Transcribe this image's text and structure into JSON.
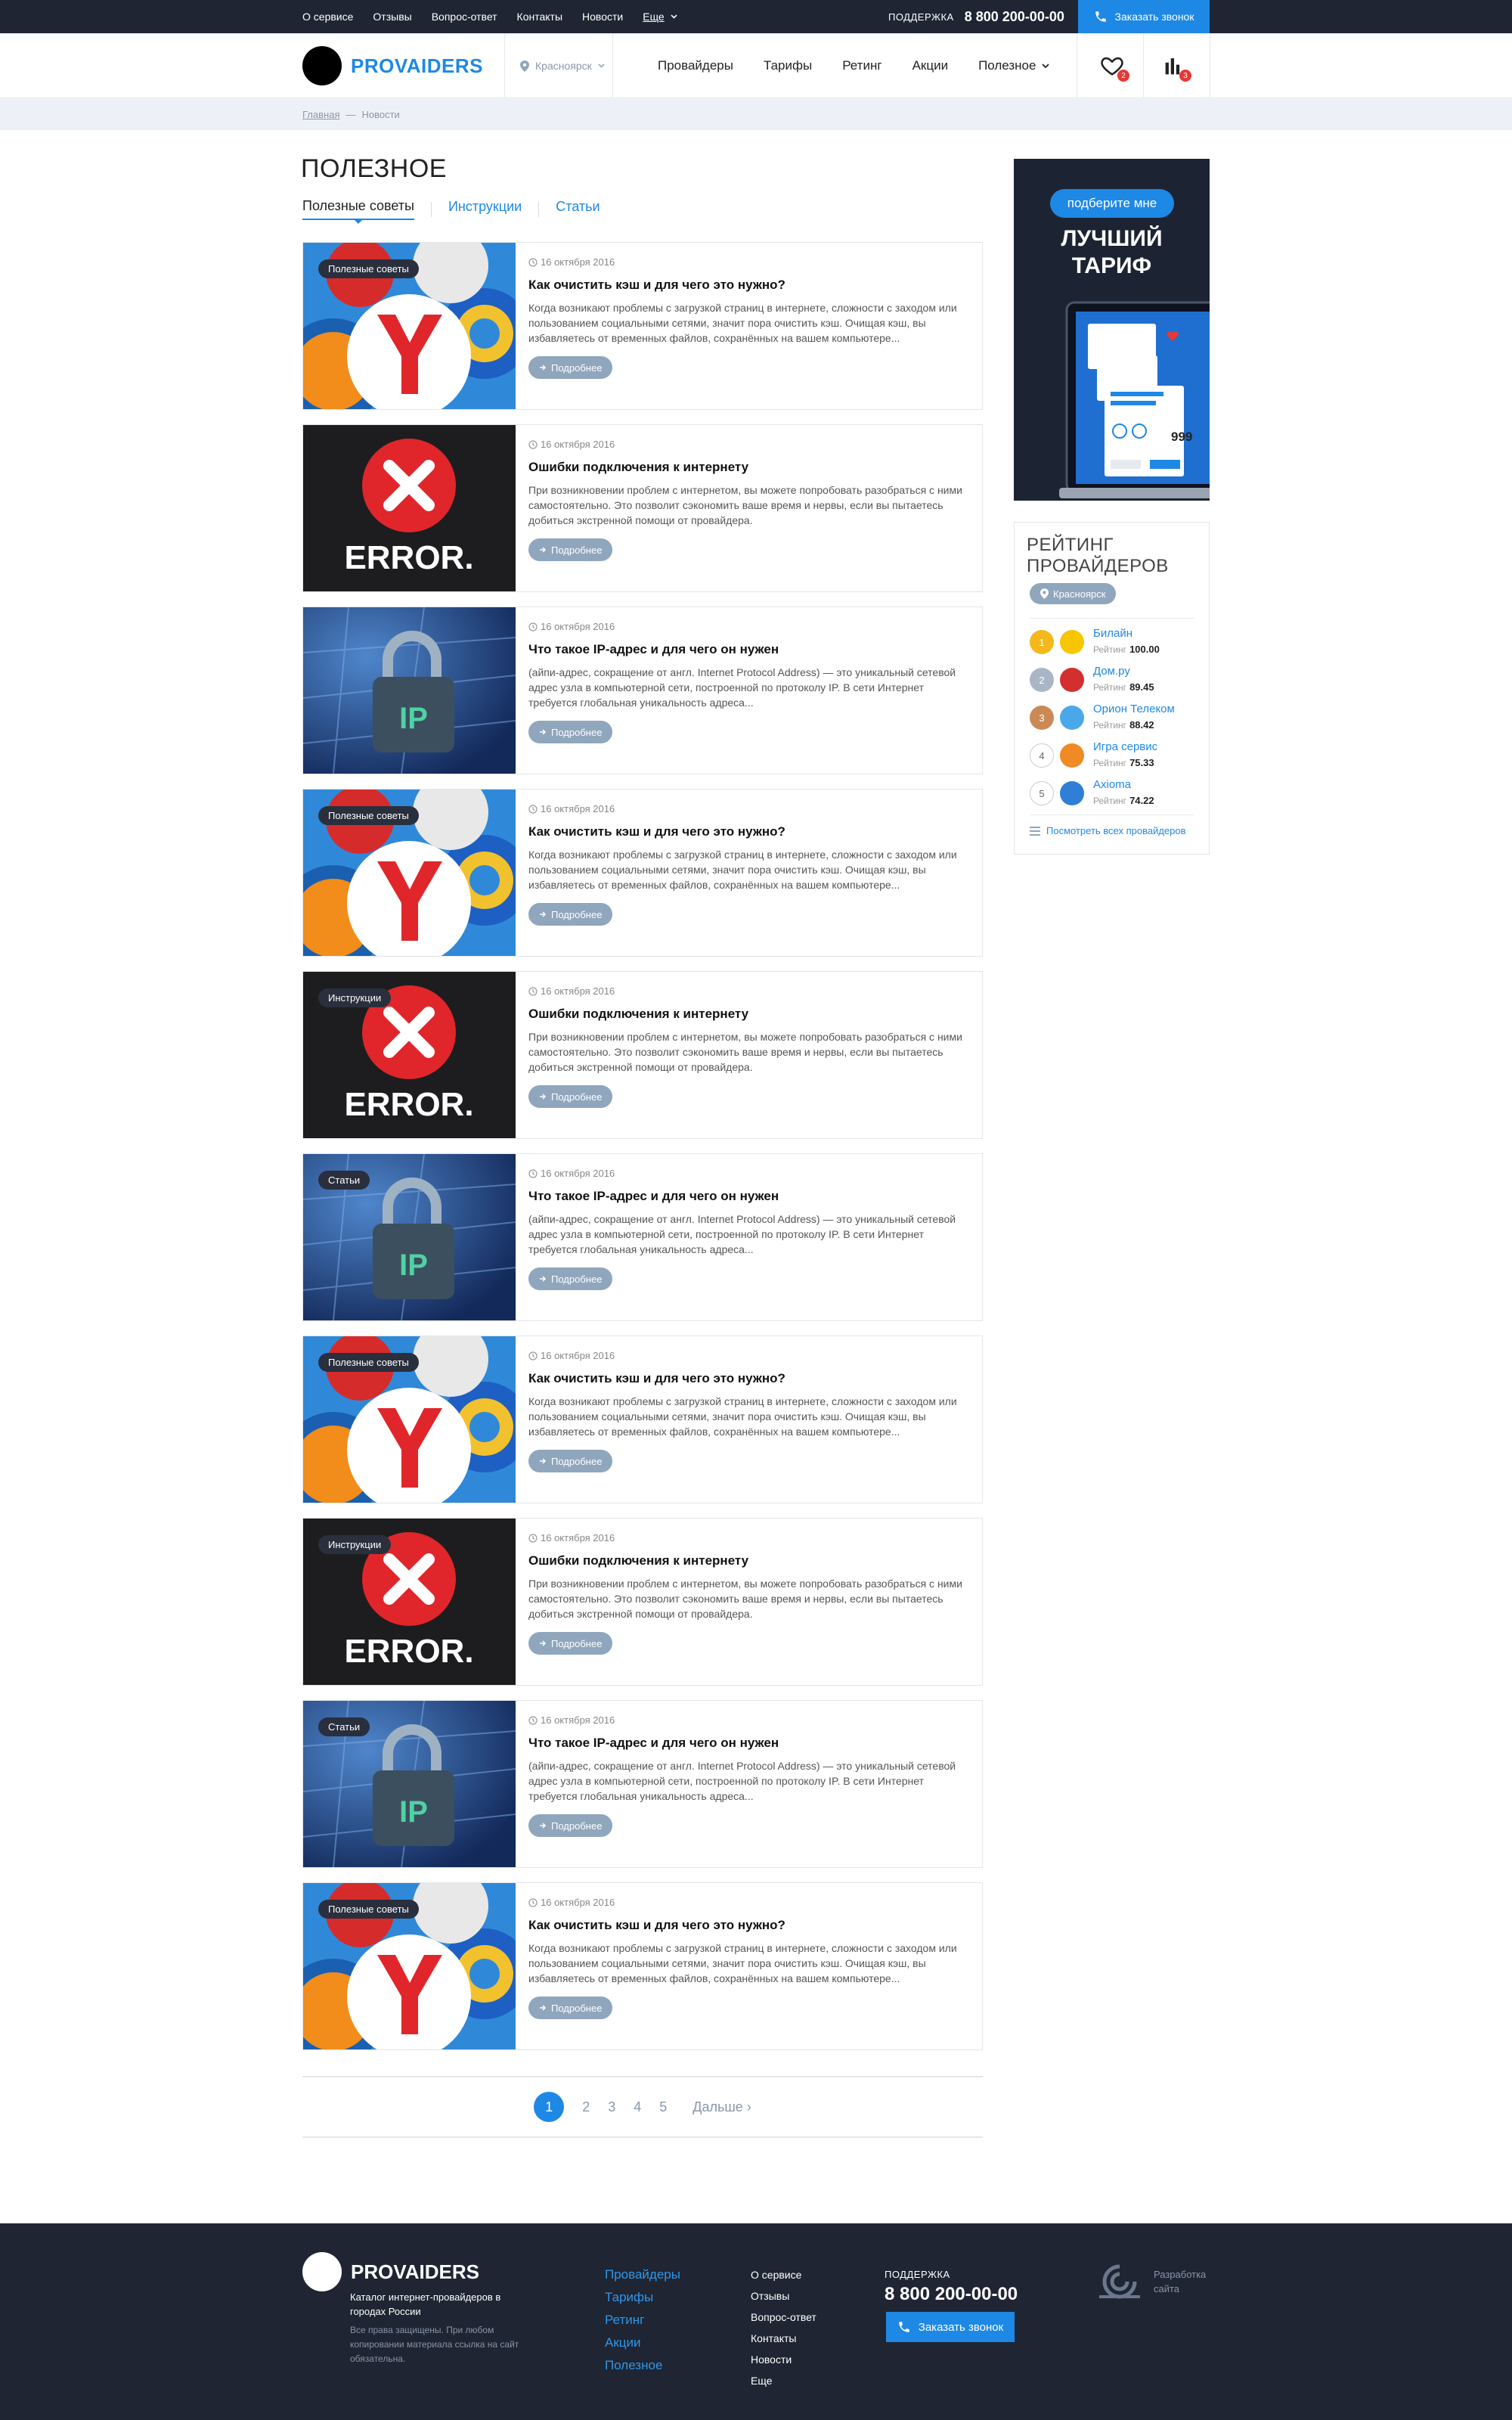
{
  "topbar": {
    "links": [
      "О сервисе",
      "Отзывы",
      "Вопрос-ответ",
      "Контакты",
      "Новости"
    ],
    "more": "Еще",
    "support_label": "ПОДДЕРЖКА",
    "support_phone": "8 800 200-00-00",
    "call_button": "Заказать звонок"
  },
  "header": {
    "logo_text": "PROVAIDERS",
    "city": "Красноярск",
    "nav": [
      "Провайдеры",
      "Тарифы",
      "Ретинг",
      "Акции"
    ],
    "nav_more": "Полезное",
    "favorites_count": "2",
    "compare_count": "3"
  },
  "breadcrumbs": {
    "home": "Главная",
    "separator": "—",
    "current": "Новости"
  },
  "page": {
    "title": "ПОЛЕЗНОЕ",
    "tabs": [
      {
        "label": "Полезные советы",
        "active": true
      },
      {
        "label": "Инструкции",
        "active": false
      },
      {
        "label": "Статьи",
        "active": false
      }
    ]
  },
  "articles": [
    {
      "art": "browsers",
      "tag": "Полезные советы",
      "date": "16 октября 2016",
      "title": "Как очистить кэш и для чего это нужно?",
      "excerpt": "Когда возникают проблемы с загрузкой страниц в интернете, сложности с заходом или пользованием социальными сетями, значит пора очистить кэш. Очищая кэш, вы избавляетесь от временных файлов, сохранённых на вашем компьютере...",
      "more": "Подробнее"
    },
    {
      "art": "error",
      "tag": "",
      "date": "16 октября 2016",
      "title": "Ошибки подключения к интернету",
      "excerpt": "При возникновении проблем с интернетом, вы можете попробовать разобраться с ними самостоятельно. Это позволит сэкономить ваше время и нервы, если вы пытаетесь добиться экстренной помощи от провайдера.",
      "more": "Подробнее"
    },
    {
      "art": "ip",
      "tag": "",
      "date": "16 октября 2016",
      "title": "Что такое IP-адрес и для чего он нужен",
      "excerpt": " (айпи-адрес, сокращение от англ. Internet Protocol Address) — это уникальный сетевой адрес узла в компьютерной сети, построенной по протоколу IP. В сети Интернет требуется глобальная уникальность адреса...",
      "more": "Подробнее"
    },
    {
      "art": "browsers",
      "tag": "Полезные советы",
      "date": "16 октября 2016",
      "title": "Как очистить кэш и для чего это нужно?",
      "excerpt": "Когда возникают проблемы с загрузкой страниц в интернете, сложности с заходом или пользованием социальными сетями, значит пора очистить кэш. Очищая кэш, вы избавляетесь от временных файлов, сохранённых на вашем компьютере...",
      "more": "Подробнее"
    },
    {
      "art": "error",
      "tag": "Инструкции",
      "date": "16 октября 2016",
      "title": "Ошибки подключения к интернету",
      "excerpt": "При возникновении проблем с интернетом, вы можете попробовать разобраться с ними самостоятельно. Это позволит сэкономить ваше время и нервы, если вы пытаетесь добиться экстренной помощи от провайдера.",
      "more": "Подробнее"
    },
    {
      "art": "ip",
      "tag": "Статьи",
      "date": "16 октября 2016",
      "title": "Что такое IP-адрес и для чего он нужен",
      "excerpt": " (айпи-адрес, сокращение от англ. Internet Protocol Address) — это уникальный сетевой адрес узла в компьютерной сети, построенной по протоколу IP. В сети Интернет требуется глобальная уникальность адреса...",
      "more": "Подробнее"
    },
    {
      "art": "browsers",
      "tag": "Полезные советы",
      "date": "16 октября 2016",
      "title": "Как очистить кэш и для чего это нужно?",
      "excerpt": "Когда возникают проблемы с загрузкой страниц в интернете, сложности с заходом или пользованием социальными сетями, значит пора очистить кэш. Очищая кэш, вы избавляетесь от временных файлов, сохранённых на вашем компьютере...",
      "more": "Подробнее"
    },
    {
      "art": "error",
      "tag": "Инструкции",
      "date": "16 октября 2016",
      "title": "Ошибки подключения к интернету",
      "excerpt": "При возникновении проблем с интернетом, вы можете попробовать разобраться с ними самостоятельно. Это позволит сэкономить ваше время и нервы, если вы пытаетесь добиться экстренной помощи от провайдера.",
      "more": "Подробнее"
    },
    {
      "art": "ip",
      "tag": "Статьи",
      "date": "16 октября 2016",
      "title": "Что такое IP-адрес и для чего он нужен",
      "excerpt": " (айпи-адрес, сокращение от англ. Internet Protocol Address) — это уникальный сетевой адрес узла в компьютерной сети, построенной по протоколу IP. В сети Интернет требуется глобальная уникальность адреса...",
      "more": "Подробнее"
    },
    {
      "art": "browsers",
      "tag": "Полезные советы",
      "date": "16 октября 2016",
      "title": "Как очистить кэш и для чего это нужно?",
      "excerpt": "Когда возникают проблемы с загрузкой страниц в интернете, сложности с заходом или пользованием социальными сетями, значит пора очистить кэш. Очищая кэш, вы избавляетесь от временных файлов, сохранённых на вашем компьютере...",
      "more": "Подробнее"
    }
  ],
  "pagination": {
    "pages": [
      "1",
      "2",
      "3",
      "4",
      "5"
    ],
    "current": "1",
    "next": "Дальше ›"
  },
  "promo": {
    "pill": "подберите мне",
    "line1": "ЛУЧШИЙ",
    "line2": "ТАРИФ",
    "screen_price": "999"
  },
  "rating": {
    "title_line1": "РЕЙТИНГ",
    "title_line2": "ПРОВАЙДЕРОВ",
    "city": "Красноярск",
    "rating_label": "Рейтинг",
    "items": [
      {
        "rank": "1",
        "name": "Билайн",
        "score": "100.00",
        "rank_color": "#f5b81c",
        "logo_color": "#f7c600"
      },
      {
        "rank": "2",
        "name": "Дом.ру",
        "score": "89.45",
        "rank_color": "#aab6c6",
        "logo_color": "#d32f2f"
      },
      {
        "rank": "3",
        "name": "Орион Телеком",
        "score": "88.42",
        "rank_color": "#c98a55",
        "logo_color": "#4aa8e8"
      },
      {
        "rank": "4",
        "name": "Игра сервис",
        "score": "75.33",
        "rank_color": "#ffffff",
        "logo_color": "#f08a24"
      },
      {
        "rank": "5",
        "name": "Axioma",
        "score": "74.22",
        "rank_color": "#ffffff",
        "logo_color": "#2f7fd6"
      }
    ],
    "view_all": "Посмотреть всех провайдеров"
  },
  "footer": {
    "logo_text": "PROVAIDERS",
    "description": "Каталог интернет-провайдеров в городах России",
    "rights": "Все права защищены. При любом копировании материала ссылка на сайт обязательна.",
    "nav_primary": [
      "Провайдеры",
      "Тарифы",
      "Ретинг",
      "Акции",
      "Полезное"
    ],
    "nav_secondary": [
      "О сервисе",
      "Отзывы",
      "Вопрос-ответ",
      "Контакты",
      "Новости",
      "Еще"
    ],
    "support_label": "ПОДДЕРЖКА",
    "support_phone": "8 800 200-00-00",
    "call_button": "Заказать звонок",
    "developer_line1": "Разработка",
    "developer_line2": "сайта"
  },
  "colors": {
    "accent": "#1e88e5",
    "dark": "#1f2533",
    "muted_button": "#8fa6bd"
  }
}
